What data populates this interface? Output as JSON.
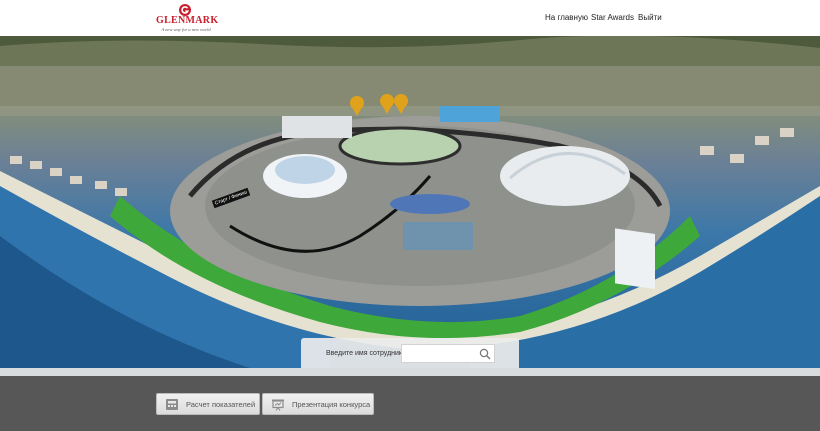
{
  "header": {
    "logo": {
      "wordmark": "GLENMARK",
      "tagline": "A new way for a new world"
    },
    "nav": {
      "home": "На главную",
      "awards": "Star Awards",
      "logout": "Выйти"
    }
  },
  "hero": {
    "track_sign": "Старт / Финиш",
    "marker_icons": [
      "location-pin-icon",
      "location-pin-icon",
      "location-pin-icon"
    ]
  },
  "search": {
    "label": "Введите имя сотрудника",
    "placeholder": "",
    "value": ""
  },
  "footer": {
    "calc_button": "Расчет показателей",
    "presentation_button": "Презентация конкурса"
  },
  "colors": {
    "brand_red": "#c8202e",
    "footer_bg": "#575757",
    "grass": "#3ea83a",
    "sea": "#2a6ea6"
  }
}
